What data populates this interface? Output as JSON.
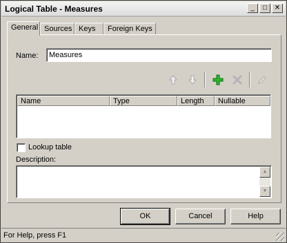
{
  "window": {
    "title": "Logical Table - Measures"
  },
  "title_buttons": {
    "minimize": "_",
    "maximize": "□",
    "close": "✕"
  },
  "tabs": [
    {
      "label": "General",
      "active": true
    },
    {
      "label": "Sources",
      "active": false
    },
    {
      "label": "Keys",
      "active": false
    },
    {
      "label": "Foreign Keys",
      "active": false
    }
  ],
  "general": {
    "name_label": "Name:",
    "name_value": "Measures",
    "columns_table": {
      "headers": [
        "Name",
        "Type",
        "Length",
        "Nullable"
      ],
      "rows": []
    },
    "lookup_label": "Lookup table",
    "lookup_checked": false,
    "description_label": "Description:",
    "description_value": ""
  },
  "toolbar": {
    "icons": [
      "arrow-up-icon",
      "arrow-down-icon",
      "add-icon",
      "delete-icon",
      "edit-icon"
    ],
    "accent_add": "#1a9e1a"
  },
  "buttons": {
    "ok": "OK",
    "cancel": "Cancel",
    "help": "Help"
  },
  "status": {
    "text": "For Help, press F1"
  }
}
